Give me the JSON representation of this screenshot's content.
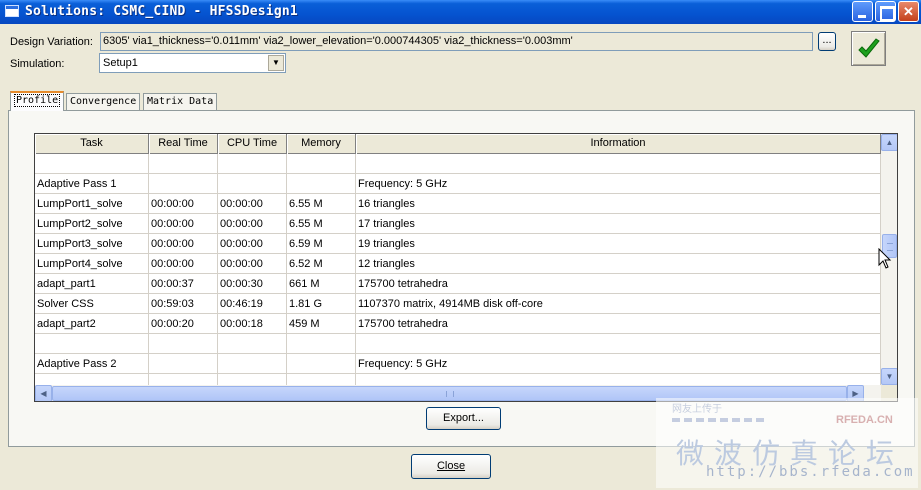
{
  "window": {
    "title": "Solutions: CSMC_CIND - HFSSDesign1"
  },
  "design_variation": {
    "label": "Design Variation:",
    "value": "6305' via1_thickness='0.011mm' via2_lower_elevation='0.000744305' via2_thickness='0.003mm'",
    "browse_label": "..."
  },
  "simulation": {
    "label": "Simulation:",
    "selected": "Setup1"
  },
  "tabs": [
    {
      "label": "Profile",
      "active": true
    },
    {
      "label": "Convergence",
      "active": false
    },
    {
      "label": "Matrix Data",
      "active": false
    }
  ],
  "table": {
    "columns": [
      "Task",
      "Real Time",
      "CPU Time",
      "Memory",
      "Information"
    ],
    "rows": [
      [
        "",
        "",
        "",
        "",
        ""
      ],
      [
        "Adaptive Pass 1",
        "",
        "",
        "",
        "Frequency: 5  GHz"
      ],
      [
        "LumpPort1_solve",
        "00:00:00",
        "00:00:00",
        "6.55 M",
        "16 triangles"
      ],
      [
        "LumpPort2_solve",
        "00:00:00",
        "00:00:00",
        "6.55 M",
        "17 triangles"
      ],
      [
        "LumpPort3_solve",
        "00:00:00",
        "00:00:00",
        "6.59 M",
        "19 triangles"
      ],
      [
        "LumpPort4_solve",
        "00:00:00",
        "00:00:00",
        "6.52 M",
        "12 triangles"
      ],
      [
        "adapt_part1",
        "00:00:37",
        "00:00:30",
        "661 M",
        "175700 tetrahedra"
      ],
      [
        "Solver CSS",
        "00:59:03",
        "00:46:19",
        "1.81 G",
        "1107370 matrix, 4914MB disk off-core"
      ],
      [
        "adapt_part2",
        "00:00:20",
        "00:00:18",
        "459 M",
        "175700 tetrahedra"
      ],
      [
        "",
        "",
        "",
        "",
        ""
      ],
      [
        "Adaptive Pass 2",
        "",
        "",
        "",
        "Frequency: 5  GHz"
      ],
      [
        "",
        "",
        "",
        "",
        ""
      ]
    ]
  },
  "buttons": {
    "export": "Export...",
    "close": "Close"
  },
  "watermark": {
    "top": "网友上传于",
    "brand": "RFEDA.CN",
    "big": "微波仿真论坛",
    "url": "http://bbs.rfeda.com"
  },
  "colors": {
    "titlebar": "#0553d0",
    "dialog_bg": "#ece9d8",
    "check_green": "#1ea01e"
  }
}
